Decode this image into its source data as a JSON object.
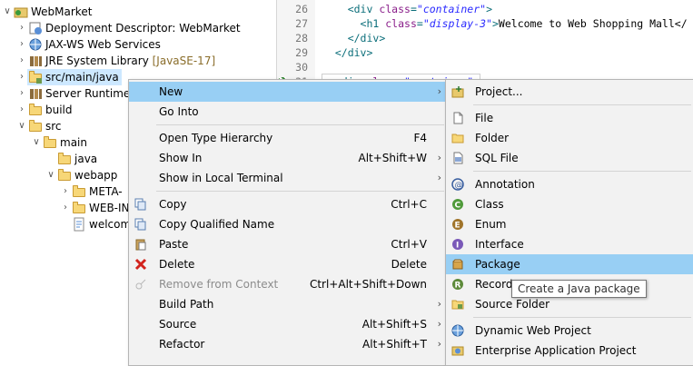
{
  "explorer": {
    "rows": [
      {
        "label": "WebMarket",
        "icon": "project-icon"
      },
      {
        "label": "Deployment Descriptor: WebMarket",
        "icon": "deployment-descriptor-icon"
      },
      {
        "label": "JAX-WS Web Services",
        "icon": "web-services-icon"
      },
      {
        "label": "JRE System Library",
        "extra": "[JavaSE-17]",
        "icon": "library-icon"
      },
      {
        "label": "src/main/java",
        "icon": "source-folder-icon"
      },
      {
        "label": "Server Runtime",
        "icon": "library-icon"
      },
      {
        "label": "build",
        "icon": "folder-icon"
      },
      {
        "label": "src",
        "icon": "folder-icon"
      },
      {
        "label": "main",
        "icon": "folder-icon"
      },
      {
        "label": "java",
        "icon": "folder-icon"
      },
      {
        "label": "webapp",
        "icon": "folder-icon"
      },
      {
        "label": "META-",
        "icon": "folder-icon"
      },
      {
        "label": "WEB-IN",
        "icon": "folder-icon"
      },
      {
        "label": "welcom",
        "icon": "file-icon"
      }
    ]
  },
  "editor": {
    "lines": [
      {
        "num": "26",
        "indent": "    ",
        "parts": [
          [
            "tag",
            "<div "
          ],
          [
            "attr",
            "class"
          ],
          [
            "tag",
            "="
          ],
          [
            "str",
            "\"container\""
          ],
          [
            "tag",
            ">"
          ]
        ]
      },
      {
        "num": "27",
        "indent": "      ",
        "parts": [
          [
            "tag",
            "<h1 "
          ],
          [
            "attr",
            "class"
          ],
          [
            "tag",
            "="
          ],
          [
            "str",
            "\"display-3\""
          ],
          [
            "tag",
            ">"
          ],
          [
            "text",
            "Welcome to Web Shopping Mall</"
          ]
        ]
      },
      {
        "num": "28",
        "indent": "    ",
        "parts": [
          [
            "tag",
            "</div>"
          ]
        ]
      },
      {
        "num": "29",
        "indent": "  ",
        "parts": [
          [
            "tag",
            "</div>"
          ]
        ]
      },
      {
        "num": "30",
        "indent": "",
        "parts": []
      },
      {
        "num": "31",
        "indent": "  ",
        "parts": [
          [
            "tag",
            "<div "
          ],
          [
            "attr",
            "class"
          ],
          [
            "tag",
            "="
          ],
          [
            "str",
            "\"container\""
          ],
          [
            "tag",
            ">"
          ]
        ]
      }
    ]
  },
  "context_menu": {
    "items": [
      {
        "label": "New",
        "shortcut": "",
        "submenu": true,
        "highlighted": true
      },
      {
        "label": "Go Into",
        "shortcut": ""
      },
      {
        "sep": true
      },
      {
        "label": "Open Type Hierarchy",
        "shortcut": "F4"
      },
      {
        "label": "Show In",
        "shortcut": "Alt+Shift+W",
        "submenu": true
      },
      {
        "label": "Show in Local Terminal",
        "shortcut": "",
        "submenu": true
      },
      {
        "sep": true
      },
      {
        "label": "Copy",
        "shortcut": "Ctrl+C",
        "icon": "copy-icon"
      },
      {
        "label": "Copy Qualified Name",
        "shortcut": "",
        "icon": "copy-icon"
      },
      {
        "label": "Paste",
        "shortcut": "Ctrl+V",
        "icon": "paste-icon"
      },
      {
        "label": "Delete",
        "shortcut": "Delete",
        "icon": "delete-icon"
      },
      {
        "label": "Remove from Context",
        "shortcut": "Ctrl+Alt+Shift+Down",
        "disabled": true,
        "icon": "remove-context-icon"
      },
      {
        "label": "Build Path",
        "shortcut": "",
        "submenu": true
      },
      {
        "label": "Source",
        "shortcut": "Alt+Shift+S",
        "submenu": true
      },
      {
        "label": "Refactor",
        "shortcut": "Alt+Shift+T",
        "submenu": true
      }
    ]
  },
  "submenu": {
    "items": [
      {
        "label": "Project...",
        "icon": "project-icon"
      },
      {
        "sep": true
      },
      {
        "label": "File",
        "icon": "file-icon"
      },
      {
        "label": "Folder",
        "icon": "folder-icon"
      },
      {
        "label": "SQL File",
        "icon": "sql-file-icon"
      },
      {
        "sep": true
      },
      {
        "label": "Annotation",
        "icon": "annotation-icon"
      },
      {
        "label": "Class",
        "icon": "class-icon"
      },
      {
        "label": "Enum",
        "icon": "enum-icon"
      },
      {
        "label": "Interface",
        "icon": "interface-icon"
      },
      {
        "label": "Package",
        "icon": "package-icon",
        "highlighted": true
      },
      {
        "label": "Record",
        "icon": "record-icon"
      },
      {
        "label": "Source Folder",
        "icon": "source-folder-icon"
      },
      {
        "sep": true
      },
      {
        "label": "Dynamic Web Project",
        "icon": "web-project-icon"
      },
      {
        "label": "Enterprise Application Project",
        "icon": "ear-project-icon"
      }
    ]
  },
  "tooltip": {
    "text": "Create a Java package"
  },
  "colors": {
    "highlight": "#98cff4",
    "selection": "#cde8ff",
    "menu_bg": "#f2f2f2"
  }
}
